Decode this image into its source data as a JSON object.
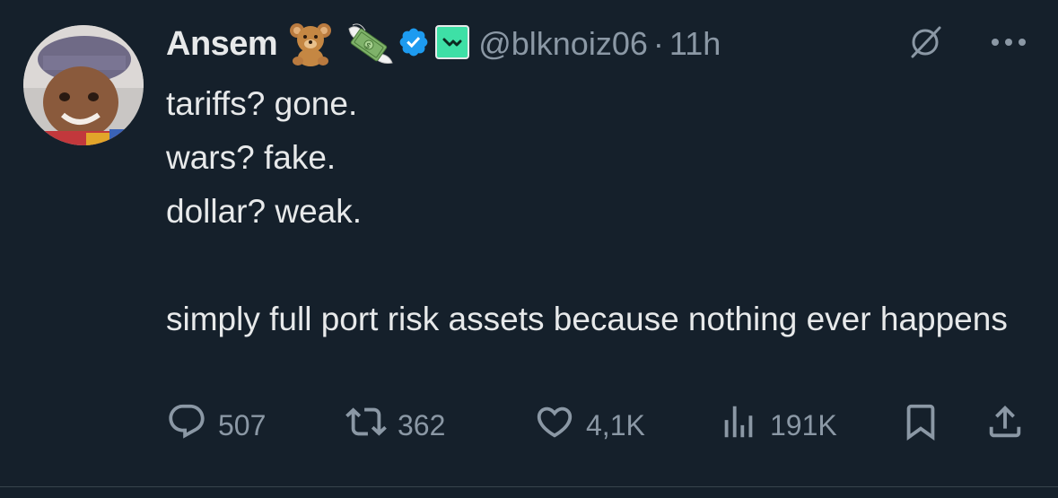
{
  "author": {
    "display_name": "Ansem",
    "handle": "@blknoiz06",
    "time": "11h",
    "separator": "·",
    "emojis": [
      "teddy-bear-emoji",
      "money-with-wings-emoji"
    ],
    "verified": true
  },
  "tweet": {
    "text": "tariffs? gone.\nwars? fake.\ndollar? weak.\n\nsimply full port risk assets because nothing ever happens"
  },
  "actions": {
    "replies": "507",
    "reposts": "362",
    "likes": "4,1K",
    "views": "191K"
  },
  "colors": {
    "background": "#15202b",
    "text": "#e7e9ea",
    "secondary": "#8b98a5",
    "verified_blue": "#1d9bf0",
    "affiliate_green": "#3ee0a6"
  }
}
